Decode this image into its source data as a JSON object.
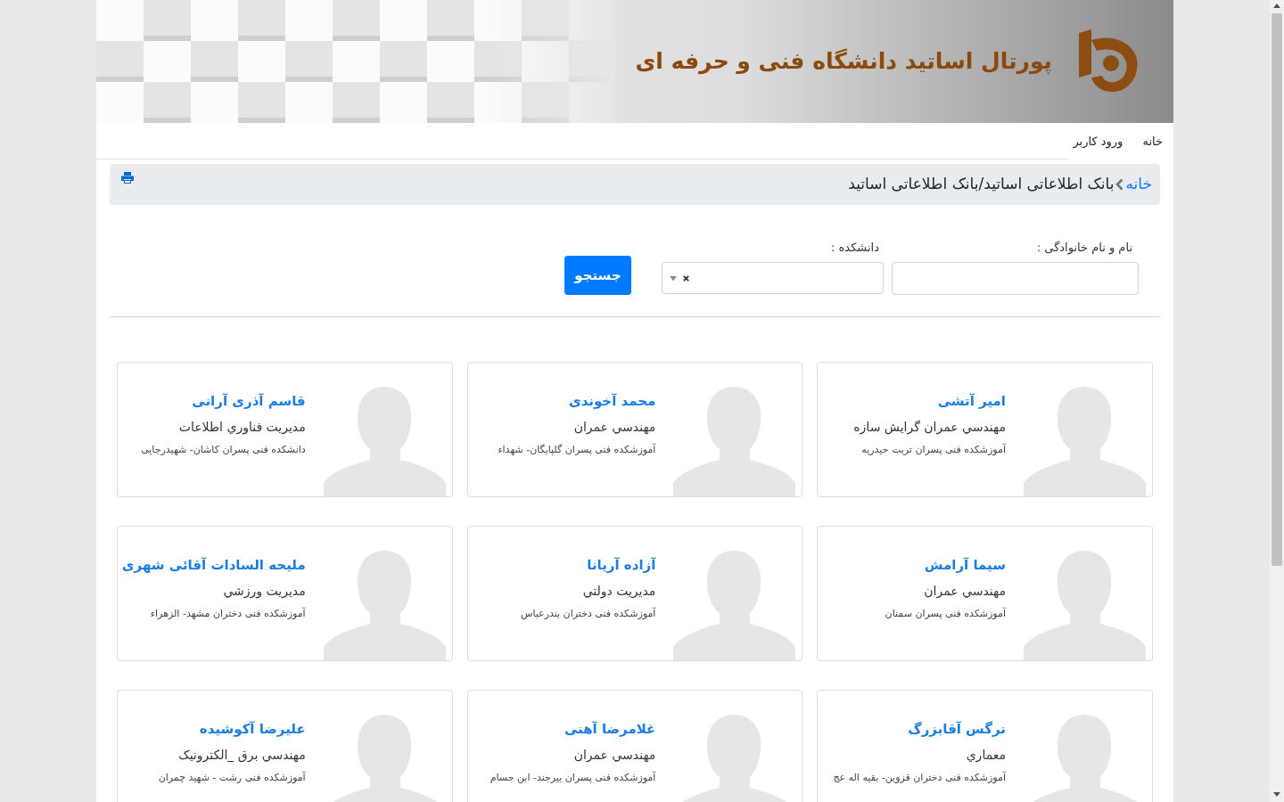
{
  "header": {
    "title": "پورتال اساتید دانشگاه فنی و حرفه ای"
  },
  "nav": [
    {
      "label": "خانه"
    },
    {
      "label": "ورود کاربر"
    }
  ],
  "breadcrumb": {
    "home": "خانه",
    "trail": "بانک اطلاعاتی اساتید/بانک اطلاعاتی اساتید"
  },
  "search": {
    "fields": [
      {
        "label": "نام و نام خانوادگی :",
        "kind": "text"
      },
      {
        "label": "دانشکده :",
        "kind": "select"
      }
    ],
    "button": "جستجو"
  },
  "professors": [
    {
      "name": "امیر آتشی",
      "field": "مهندسي عمران گرایش سازه",
      "institution": "آموزشکده فنی پسران تربت حیدریه"
    },
    {
      "name": "محمد آخوندی",
      "field": "مهندسي عمران",
      "institution": "آموزشکده فنی پسران گلپایگان- شهداء"
    },
    {
      "name": "قاسم آذری آرانی",
      "field": "مدیریت فناوري اطلاعات",
      "institution": "دانشکده فنی پسران کاشان- شهیدرجایی"
    },
    {
      "name": "سیما آرامش",
      "field": "مهندسي عمران",
      "institution": "آموزشکده فنی پسران سمنان"
    },
    {
      "name": "آزاده آریانا",
      "field": "مدیریت دولتي",
      "institution": "آموزشکده فنی دختران بندرعباس"
    },
    {
      "name": "ملیحه السادات آقائی شهری",
      "field": "مدیریت ورزشي",
      "institution": "آموزشکده فنی دختران مشهد- الزهراء"
    },
    {
      "name": "نرگس آقابزرگ",
      "field": "معماري",
      "institution": "آموزشکده فنی دختران قزوین- بقیه اله عج"
    },
    {
      "name": "غلامرضا آهنی",
      "field": "مهندسي عمران",
      "institution": "آموزشکده فنی پسران بیرجند- ابن حسام"
    },
    {
      "name": "علیرضا آکوشیده",
      "field": "مهندسي برق _الکترونیک",
      "institution": "آموزشکده فنی رشت - شهید چمران"
    }
  ]
}
